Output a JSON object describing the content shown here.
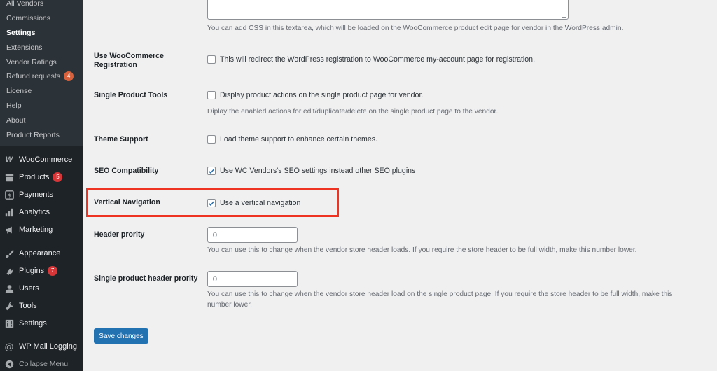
{
  "sidebar": {
    "submenu": [
      {
        "label": "All Vendors"
      },
      {
        "label": "Commissions"
      },
      {
        "label": "Settings",
        "current": true
      },
      {
        "label": "Extensions"
      },
      {
        "label": "Vendor Ratings"
      },
      {
        "label": "Refund requests",
        "badge": "4"
      },
      {
        "label": "License"
      },
      {
        "label": "Help"
      },
      {
        "label": "About"
      },
      {
        "label": "Product Reports"
      }
    ],
    "menu": {
      "woocommerce": {
        "label": "WooCommerce",
        "icon": "woo-icon"
      },
      "products": {
        "label": "Products",
        "badge": "5",
        "icon": "archive-icon"
      },
      "payments": {
        "label": "Payments",
        "icon": "dollar-icon"
      },
      "analytics": {
        "label": "Analytics",
        "icon": "bar-chart-icon"
      },
      "marketing": {
        "label": "Marketing",
        "icon": "megaphone-icon"
      },
      "appearance": {
        "label": "Appearance",
        "icon": "paintbrush-icon"
      },
      "plugins": {
        "label": "Plugins",
        "badge": "7",
        "icon": "plug-icon"
      },
      "users": {
        "label": "Users",
        "icon": "user-icon"
      },
      "tools": {
        "label": "Tools",
        "icon": "wrench-icon"
      },
      "settings": {
        "label": "Settings",
        "icon": "settings-icon"
      },
      "wp_mail_logging": {
        "label": "WP Mail Logging",
        "icon": "at-icon"
      },
      "collapse": {
        "label": "Collapse Menu",
        "icon": "collapse-arrow-icon"
      }
    }
  },
  "main": {
    "custom_css_desc": "You can add CSS in this textarea, which will be loaded on the WooCommerce product edit page for vendor in the WordPress admin.",
    "rows": {
      "woo_registration": {
        "label_line1": "Use WooCommerce",
        "label_line2": "Registration",
        "checkbox_label": "This will redirect the WordPress registration to WooCommerce my-account page for registration.",
        "checked": false
      },
      "single_product_tools": {
        "label": "Single Product Tools",
        "checkbox_label": "Display product actions on the single product page for vendor.",
        "desc": "Diplay the enabled actions for edit/duplicate/delete on the single product page to the vendor.",
        "checked": false
      },
      "theme_support": {
        "label": "Theme Support",
        "checkbox_label": "Load theme support to enhance certain themes.",
        "checked": false
      },
      "seo": {
        "label": "SEO Compatibility",
        "checkbox_label": "Use WC Vendors's SEO settings instead other SEO plugins",
        "checked": true
      },
      "vertical_nav": {
        "label": "Vertical Navigation",
        "checkbox_label": "Use a vertical navigation",
        "checked": true
      },
      "header_priority": {
        "label": "Header prority",
        "value": "0",
        "desc": "You can use this to change when the vendor store header loads. If you require the store header to be full width, make this number lower."
      },
      "single_header_priority": {
        "label": "Single product header prority",
        "value": "0",
        "desc_line1": "You can use this to change when the vendor store header load on the single product page. If you require the store header to be full width, make this",
        "desc_line2": "number lower."
      }
    },
    "save_label": "Save changes"
  },
  "colors": {
    "sidebar_bg": "#1d2327",
    "submenu_bg": "#2c3338",
    "accent": "#2271b1",
    "highlight": "#ee3322",
    "badge": "#d63638"
  }
}
